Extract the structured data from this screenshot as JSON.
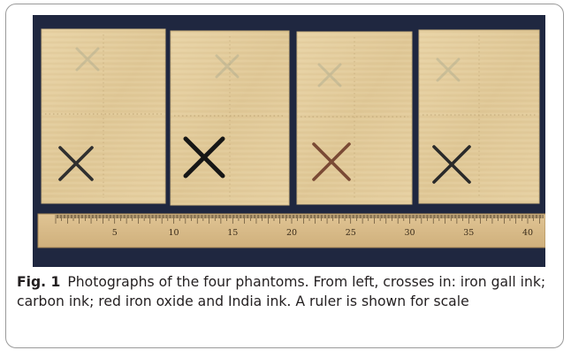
{
  "figure": {
    "label": "Fig. 1",
    "caption": "Photographs of the four phantoms. From left, crosses in: iron gall ink; carbon ink; red iron oxide and India ink. A ruler is shown for scale"
  },
  "photo": {
    "phantoms": [
      {
        "name": "iron gall ink",
        "cross_color": "#2f2f2f"
      },
      {
        "name": "carbon ink",
        "cross_color": "#161616"
      },
      {
        "name": "red iron oxide",
        "cross_color": "#7a4a35"
      },
      {
        "name": "India ink",
        "cross_color": "#2a2a2a"
      }
    ],
    "ruler_labels": [
      "5",
      "10",
      "15",
      "20",
      "25",
      "30",
      "35",
      "40"
    ],
    "colors": {
      "background": "#1f2740",
      "papyrus": "#e3cd9e",
      "ruler": "#d8b988"
    }
  }
}
